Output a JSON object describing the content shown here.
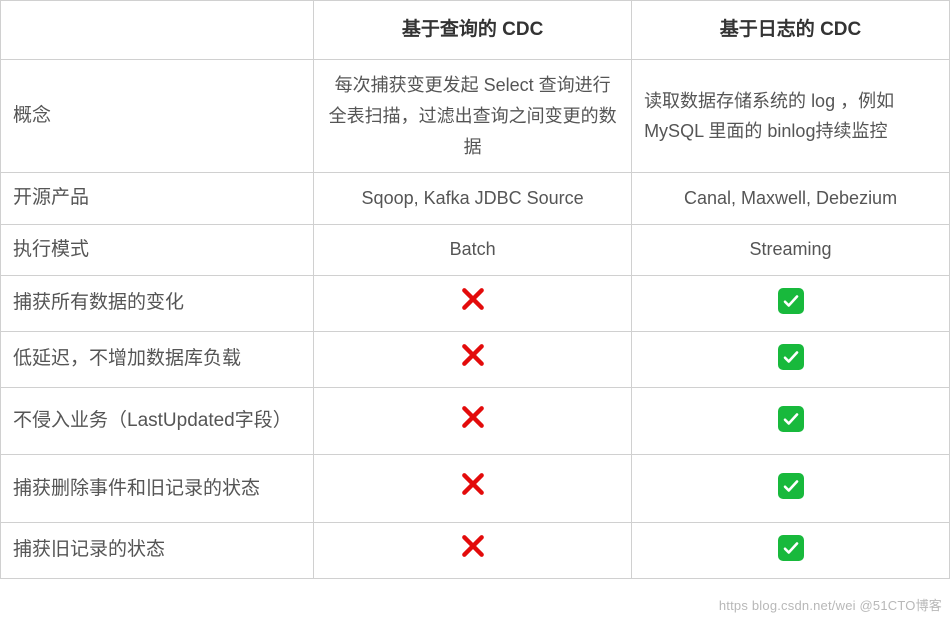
{
  "headers": {
    "blank": "",
    "col1": "基于查询的 CDC",
    "col2": "基于日志的 CDC"
  },
  "rows": [
    {
      "label": "概念",
      "col1": "每次捕获变更发起 Select 查询进行全表扫描，过滤出查询之间变更的数据",
      "col2": "读取数据存储系统的 log ，例如 MySQL 里面的 binlog持续监控",
      "type": "text",
      "concept": true
    },
    {
      "label": "开源产品",
      "col1": "Sqoop, Kafka JDBC Source",
      "col2": "Canal, Maxwell, Debezium",
      "type": "text"
    },
    {
      "label": "执行模式",
      "col1": "Batch",
      "col2": "Streaming",
      "type": "text"
    },
    {
      "label": "捕获所有数据的变化",
      "col1": "cross",
      "col2": "check",
      "type": "icon"
    },
    {
      "label": "低延迟，不增加数据库负载",
      "col1": "cross",
      "col2": "check",
      "type": "icon"
    },
    {
      "label": "不侵入业务（LastUpdated字段）",
      "col1": "cross",
      "col2": "check",
      "type": "icon",
      "tall": true
    },
    {
      "label": "捕获删除事件和旧记录的状态",
      "col1": "cross",
      "col2": "check",
      "type": "icon",
      "tall": true
    },
    {
      "label": "捕获旧记录的状态",
      "col1": "cross",
      "col2": "check",
      "type": "icon"
    }
  ],
  "watermark": "https blog.csdn.net/wei @51CTO博客",
  "chart_data": {
    "type": "table",
    "title": "",
    "columns": [
      "",
      "基于查询的 CDC",
      "基于日志的 CDC"
    ],
    "rows": [
      [
        "概念",
        "每次捕获变更发起 Select 查询进行全表扫描，过滤出查询之间变更的数据",
        "读取数据存储系统的 log ，例如 MySQL 里面的 binlog持续监控"
      ],
      [
        "开源产品",
        "Sqoop, Kafka JDBC Source",
        "Canal, Maxwell, Debezium"
      ],
      [
        "执行模式",
        "Batch",
        "Streaming"
      ],
      [
        "捕获所有数据的变化",
        "❌",
        "✅"
      ],
      [
        "低延迟，不增加数据库负载",
        "❌",
        "✅"
      ],
      [
        "不侵入业务（LastUpdated字段）",
        "❌",
        "✅"
      ],
      [
        "捕获删除事件和旧记录的状态",
        "❌",
        "✅"
      ],
      [
        "捕获旧记录的状态",
        "❌",
        "✅"
      ]
    ]
  }
}
